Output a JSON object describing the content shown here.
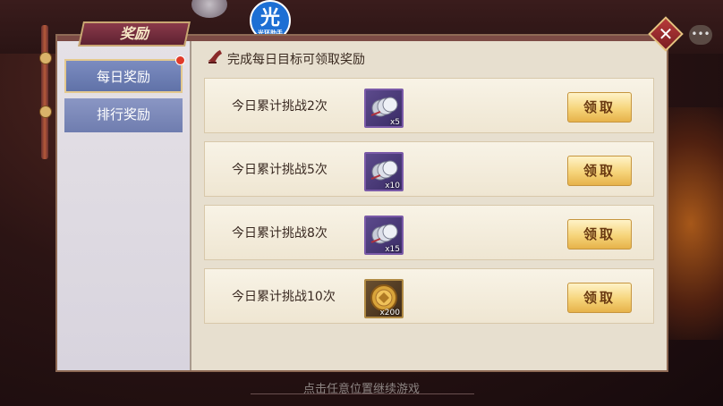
{
  "panel": {
    "title": "奖励",
    "header_text": "完成每日目标可领取奖励"
  },
  "tabs": [
    {
      "label": "每日奖励",
      "active": true
    },
    {
      "label": "排行奖励",
      "active": false
    }
  ],
  "rows": [
    {
      "label": "今日累计挑战2次",
      "item": "silver-coins",
      "qty": "x5",
      "button": "领取"
    },
    {
      "label": "今日累计挑战5次",
      "item": "silver-coins",
      "qty": "x10",
      "button": "领取"
    },
    {
      "label": "今日累计挑战8次",
      "item": "silver-coins",
      "qty": "x15",
      "button": "领取"
    },
    {
      "label": "今日累计挑战10次",
      "item": "gold-coin",
      "qty": "x200",
      "button": "领取"
    }
  ],
  "logo": {
    "glyph": "光",
    "sub": "光环助手"
  },
  "footer_text": "点击任意位置继续游戏",
  "colors": {
    "accent": "#e6b24a",
    "panel": "#eae3d3",
    "tab_active": "#6072a8"
  }
}
